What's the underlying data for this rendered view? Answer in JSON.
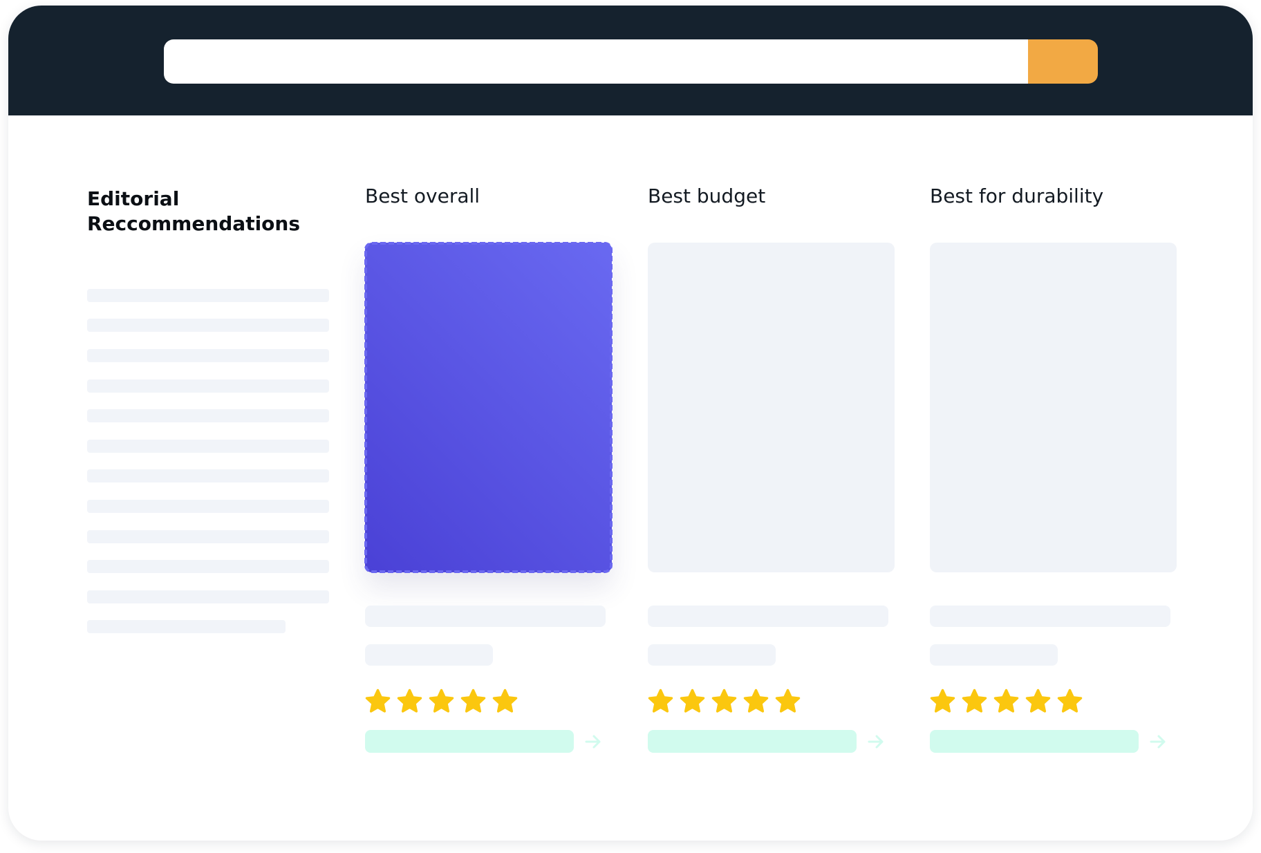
{
  "search": {
    "value": "",
    "placeholder": "",
    "button_color": "#f2a944"
  },
  "sidebar": {
    "title": "Editorial\nReccommendations",
    "line_count": 12
  },
  "columns": [
    {
      "title": "Best overall",
      "selected": true,
      "rating": 5,
      "max_rating": 5
    },
    {
      "title": "Best budget",
      "selected": false,
      "rating": 5,
      "max_rating": 5
    },
    {
      "title": "Best for durability",
      "selected": false,
      "rating": 5,
      "max_rating": 5
    }
  ],
  "icons": {
    "star": "star-icon",
    "arrow": "arrow-right-icon"
  },
  "colors": {
    "header_bg": "#15222e",
    "accent_orange": "#f2a944",
    "selected_card": "#5551e6",
    "star": "#fbc70f",
    "cta": "#d1fbee",
    "skeleton": "#f1f4f9"
  }
}
